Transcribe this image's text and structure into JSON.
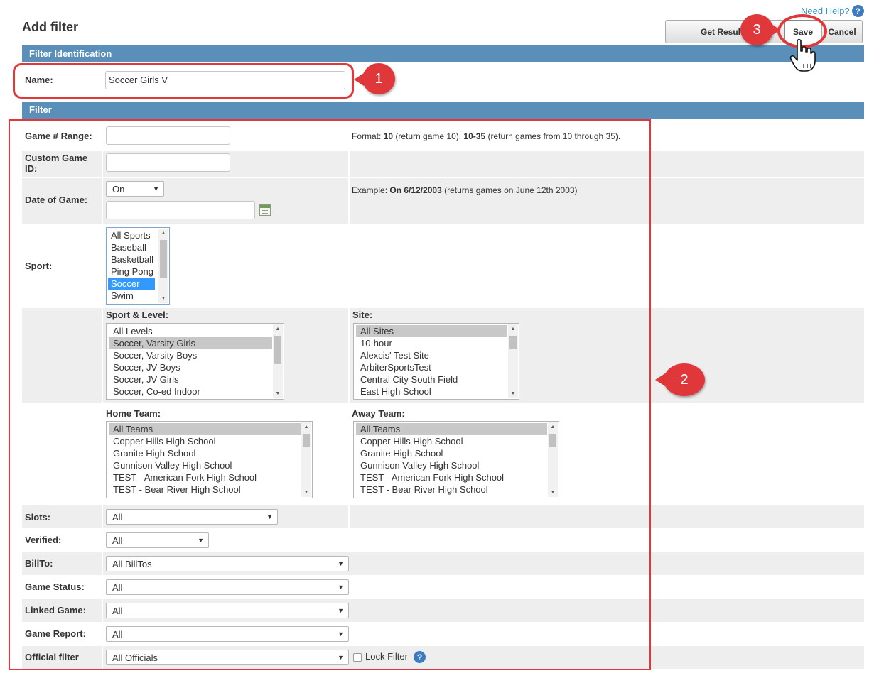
{
  "header": {
    "title": "Add filter",
    "need_help": "Need Help?",
    "buttons": {
      "get_results": "Get Resul",
      "save": "Save",
      "cancel": "Cancel"
    }
  },
  "sections": {
    "identification": "Filter Identification",
    "filter": "Filter"
  },
  "name_field": {
    "label": "Name:",
    "value": "Soccer Girls V"
  },
  "game_range": {
    "label": "Game # Range:",
    "hint_prefix": "Format: ",
    "hint_b1": "10",
    "hint_mid": " (return game 10), ",
    "hint_b2": "10-35",
    "hint_suffix": " (return games from 10 through 35)."
  },
  "custom_game_id": {
    "label": "Custom Game ID:"
  },
  "date_of_game": {
    "label": "Date of Game:",
    "operator": "On",
    "hint_prefix": "Example: ",
    "hint_b": "On 6/12/2003",
    "hint_suffix": " (returns games on June 12th 2003)"
  },
  "sport": {
    "label": "Sport:",
    "options": [
      "All Sports",
      "Baseball",
      "Basketball",
      "Ping Pong",
      "Soccer",
      "Swim"
    ],
    "selected": "Soccer"
  },
  "sport_level": {
    "label": "Sport & Level:",
    "options": [
      "All Levels",
      "Soccer, Varsity Girls",
      "Soccer, Varsity Boys",
      "Soccer, JV Boys",
      "Soccer, JV Girls",
      "Soccer, Co-ed Indoor"
    ],
    "selected": "Soccer, Varsity Girls"
  },
  "site": {
    "label": "Site:",
    "options": [
      "All Sites",
      "10-hour",
      "Alexcis' Test Site",
      "ArbiterSportsTest",
      "Central City South Field",
      "East High School"
    ],
    "selected": "All Sites"
  },
  "home_team": {
    "label": "Home Team:",
    "options": [
      "All Teams",
      "Copper Hills High School",
      "Granite High School",
      "Gunnison Valley High School",
      "TEST - American Fork High School",
      "TEST - Bear River High School"
    ],
    "selected": "All Teams"
  },
  "away_team": {
    "label": "Away Team:",
    "options": [
      "All Teams",
      "Copper Hills High School",
      "Granite High School",
      "Gunnison Valley High School",
      "TEST - American Fork High School",
      "TEST - Bear River High School"
    ],
    "selected": "All Teams"
  },
  "dropdowns": {
    "slots": {
      "label": "Slots:",
      "value": "All"
    },
    "verified": {
      "label": "Verified:",
      "value": "All"
    },
    "billto": {
      "label": "BillTo:",
      "value": "All BillTos"
    },
    "game_status": {
      "label": "Game Status:",
      "value": "All"
    },
    "linked_game": {
      "label": "Linked Game:",
      "value": "All"
    },
    "game_report": {
      "label": "Game Report:",
      "value": "All"
    },
    "official_filter": {
      "label": "Official filter",
      "value": "All Officials"
    }
  },
  "lock_filter": {
    "label": "Lock Filter",
    "checked": false
  },
  "callouts": {
    "one": "1",
    "two": "2",
    "three": "3"
  },
  "colors": {
    "section_bar": "#5a8fba",
    "callout_red": "#e0383a",
    "row_shade": "#eeeeee",
    "link_blue": "#3b8fcf"
  }
}
